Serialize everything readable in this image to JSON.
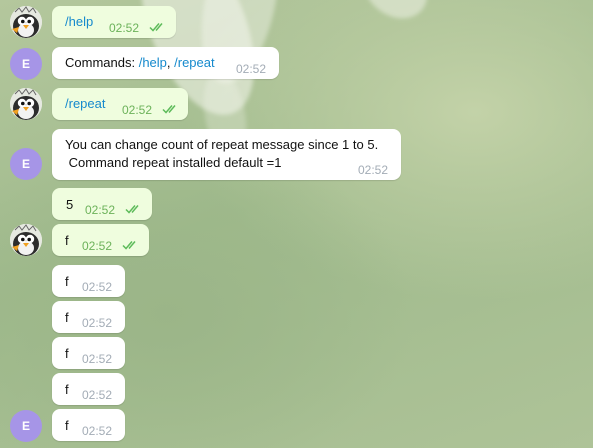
{
  "chat": {
    "user_avatar_letter": "E",
    "messages": [
      {
        "dir": "out",
        "parts": [
          {
            "t": "/help",
            "link": true
          }
        ],
        "time": "02:52",
        "status": "read"
      },
      {
        "dir": "in",
        "parts": [
          {
            "t": "Commands: "
          },
          {
            "t": "/help",
            "link": true
          },
          {
            "t": ", "
          },
          {
            "t": "/repeat",
            "link": true
          }
        ],
        "time": "02:52"
      },
      {
        "dir": "out",
        "parts": [
          {
            "t": "/repeat",
            "link": true
          }
        ],
        "time": "02:52",
        "status": "read"
      },
      {
        "dir": "in",
        "lines": [
          "You can change count of repeat message since 1 to 5.",
          " Command repeat installed default =1"
        ],
        "time": "02:52"
      },
      {
        "dir": "out",
        "parts": [
          {
            "t": "5"
          }
        ],
        "time": "02:52",
        "status": "read"
      },
      {
        "dir": "out",
        "parts": [
          {
            "t": "f"
          }
        ],
        "time": "02:52",
        "status": "read"
      },
      {
        "dir": "in",
        "parts": [
          {
            "t": "f"
          }
        ],
        "time": "02:52"
      },
      {
        "dir": "in",
        "parts": [
          {
            "t": "f"
          }
        ],
        "time": "02:52"
      },
      {
        "dir": "in",
        "parts": [
          {
            "t": "f"
          }
        ],
        "time": "02:52"
      },
      {
        "dir": "in",
        "parts": [
          {
            "t": "f"
          }
        ],
        "time": "02:52"
      },
      {
        "dir": "in",
        "parts": [
          {
            "t": "f"
          }
        ],
        "time": "02:52"
      }
    ]
  },
  "colors": {
    "outgoing_bubble": "#effdde",
    "incoming_bubble": "#ffffff",
    "link": "#168acd",
    "read_ticks": "#5dbb5a",
    "avatar_e": "#a695e7"
  },
  "icons": {
    "bot_avatar": "penguin-bird-icon",
    "read_status": "double-check-icon"
  }
}
